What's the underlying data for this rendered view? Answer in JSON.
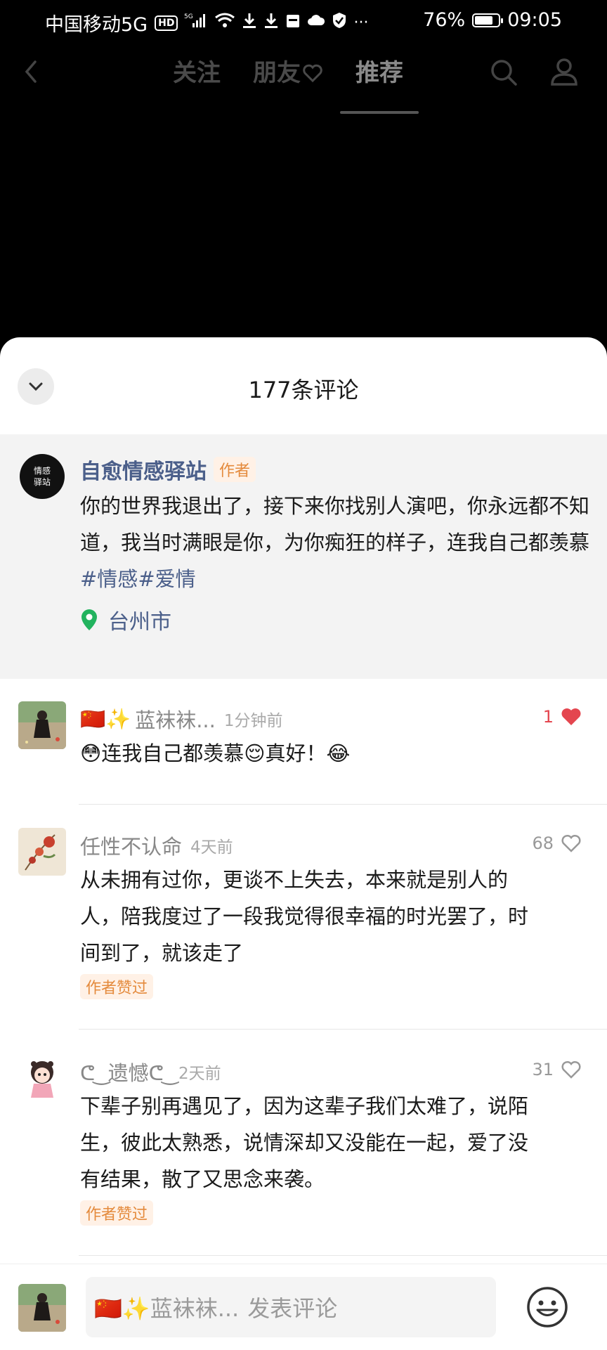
{
  "status_bar": {
    "carrier": "中国移动5G",
    "hd_badge": "HD",
    "net_badge": "5G",
    "battery_pct": "76%",
    "battery_level": 0.76,
    "time": "09:05"
  },
  "nav": {
    "tabs": [
      {
        "label": "关注"
      },
      {
        "label": "朋友"
      },
      {
        "label": "推荐"
      }
    ],
    "active_tab": "推荐"
  },
  "sheet": {
    "title": "177条评论"
  },
  "author_post": {
    "avatar_text": "情感\n驿站",
    "name": "自愈情感驿站",
    "tag": "作者",
    "text": "你的世界我退出了，接下来你找别人演吧，你永远都不知道，我当时满眼是你，为你痴狂的样子，连我自己都羡慕",
    "hashtags": [
      "#情感",
      "#爱情"
    ],
    "location": "台州市"
  },
  "comments": [
    {
      "name_prefix": "🇨🇳✨",
      "name": "蓝袜袜...",
      "time": "1分钟前",
      "text": "😳连我自己都羡慕😌真好！😂",
      "likes": "1",
      "liked": true
    },
    {
      "name": "任性不认命",
      "time": "4天前",
      "text": "从未拥有过你，更谈不上失去，本来就是别人的人，陪我度过了一段我觉得很幸福的时光罢了，时间到了，就该走了",
      "badge": "作者赞过",
      "likes": "68",
      "liked": false
    },
    {
      "name": "ᕦ ͜ 遗憾ᕦ ͜ ",
      "time": "2天前",
      "text": "下辈子别再遇见了，因为这辈子我们太难了，说陌生，彼此太熟悉，说情深却又没能在一起，爱了没有结果，散了又思念来袭。",
      "badge": "作者赞过",
      "likes": "31",
      "liked": false
    }
  ],
  "input_bar": {
    "prefix": "🇨🇳✨蓝袜袜...",
    "placeholder": "发表评论"
  },
  "colors": {
    "link": "#4b5f8a",
    "accent_orange": "#e48a3c",
    "like_red": "#e4464f"
  }
}
